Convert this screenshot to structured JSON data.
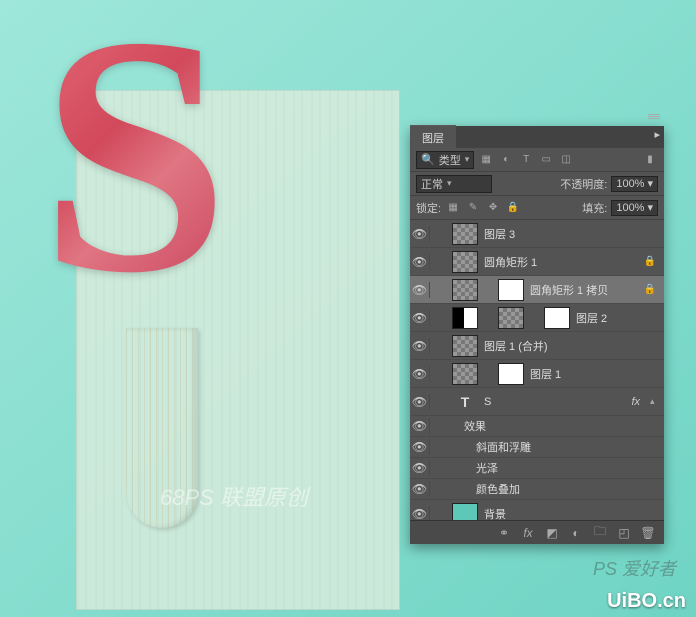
{
  "canvas": {
    "letter": "S",
    "watermark1": "68PS 联盟原创",
    "watermark2": "PS 爱好者",
    "watermark3": "UiBO.cn"
  },
  "panel": {
    "title": "图层",
    "filter": {
      "kind_label": "类型"
    },
    "blend": {
      "mode": "正常",
      "opacity_label": "不透明度:",
      "opacity_value": "100%"
    },
    "lock": {
      "label": "锁定:",
      "fill_label": "填充:",
      "fill_value": "100%"
    },
    "layers": [
      {
        "id": "l3",
        "name": "图层 3",
        "indent": 1,
        "thumb": "checker",
        "locked": false,
        "selected": false
      },
      {
        "id": "rr1",
        "name": "圆角矩形 1",
        "indent": 1,
        "thumb": "checker",
        "locked": true,
        "selected": false
      },
      {
        "id": "rr1c",
        "name": "圆角矩形 1 拷贝",
        "indent": 1,
        "thumb": "checker",
        "mask": "mask-white",
        "locked": true,
        "selected": true
      },
      {
        "id": "l2",
        "name": "图层 2",
        "indent": 1,
        "thumb": "mask-mix",
        "thumb2": "checker",
        "mask": "mask-white",
        "locked": false,
        "selected": false
      },
      {
        "id": "l1m",
        "name": "图层 1 (合并)",
        "indent": 1,
        "thumb": "checker",
        "locked": false,
        "selected": false
      },
      {
        "id": "l1",
        "name": "图层 1",
        "indent": 1,
        "thumb": "checker",
        "mask": "mask-white",
        "locked": false,
        "selected": false
      }
    ],
    "text_layer": {
      "label": "S",
      "fx_prefix": "T"
    },
    "effects": {
      "title": "效果",
      "items": [
        "斜面和浮雕",
        "光泽",
        "颜色叠加"
      ]
    },
    "bg_layer": {
      "name": "背景"
    },
    "fx_label": "fx"
  }
}
